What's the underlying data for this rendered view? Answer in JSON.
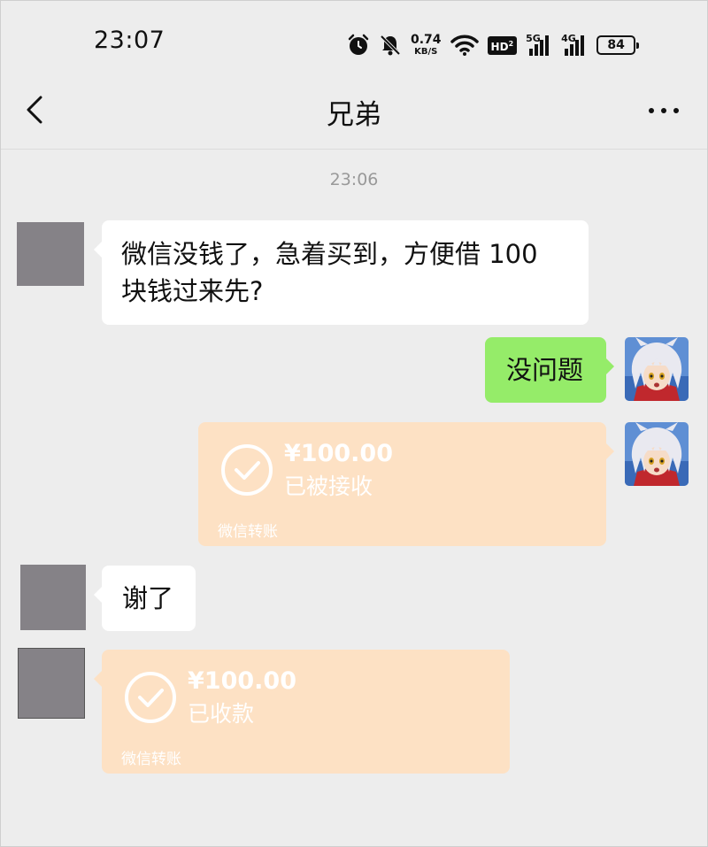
{
  "status_bar": {
    "time": "23:07",
    "net_speed_value": "0.74",
    "net_speed_unit": "KB/S",
    "hd_label": "HD",
    "hd_sub": "2",
    "sim1_gen": "5G",
    "sim2_gen": "4G",
    "battery": "84"
  },
  "nav": {
    "title": "兄弟"
  },
  "chat": {
    "timestamp": "23:06",
    "messages": [
      {
        "text": "微信没钱了，急着买到，方便借 100 块钱过来先?"
      },
      {
        "text": "没问题"
      },
      {
        "text": "谢了"
      }
    ],
    "transfers": [
      {
        "amount": "¥100.00",
        "status": "已被接收",
        "footer": "微信转账"
      },
      {
        "amount": "¥100.00",
        "status": "已收款",
        "footer": "微信转账"
      }
    ]
  },
  "colors": {
    "background": "#ededed",
    "bubble_out": "#95ec69",
    "bubble_in": "#ffffff",
    "transfer_done": "#fde1c4",
    "avatar_placeholder": "#858287"
  },
  "icons": [
    "alarm-icon",
    "mute-bell-icon",
    "wifi-icon",
    "signal-icon",
    "battery-icon",
    "back-chevron-icon",
    "more-icon",
    "check-circle-icon"
  ]
}
